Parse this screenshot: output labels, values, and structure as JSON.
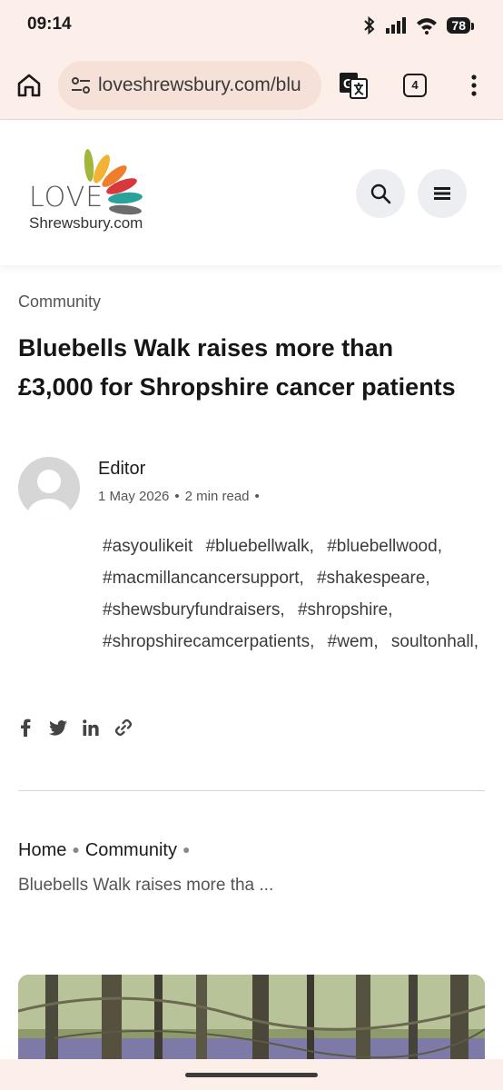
{
  "status": {
    "time": "09:14",
    "battery": "78"
  },
  "browser": {
    "url": "loveshrewsbury.com/blu",
    "tab_count": "4"
  },
  "logo": {
    "love": "LOVE",
    "site": "Shrewsbury.com"
  },
  "article": {
    "category": "Community",
    "title": "Bluebells Walk raises more than £3,000 for Shropshire cancer patients",
    "author": "Editor",
    "date": "1 May 2026",
    "read_time": "2 min read",
    "tags": [
      "#asyoulikeit",
      "#bluebellwalk,",
      "#bluebellwood,",
      "#macmillancancersupport,",
      "#shakespeare,",
      "#shewsburyfundraisers,",
      "#shropshire,",
      "#shropshirecamcerpatients,",
      "#wem,",
      "soultonhall,"
    ]
  },
  "share_icons": [
    "facebook-icon",
    "twitter-icon",
    "linkedin-icon",
    "link-icon"
  ],
  "breadcrumb": {
    "home": "Home",
    "section": "Community",
    "current": "Bluebells Walk raises more tha ..."
  },
  "colors": {
    "chrome_bg": "#fcefe9",
    "url_pill": "#f5e1d7",
    "round_button": "#edeef2"
  }
}
